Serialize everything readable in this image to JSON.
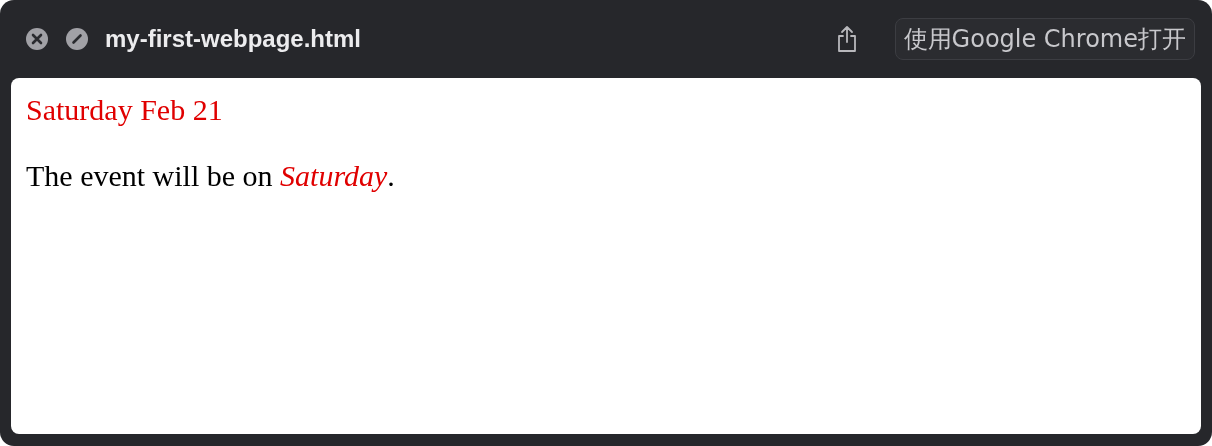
{
  "window": {
    "title": "my-first-webpage.html",
    "open_button": "使用Google Chrome打开"
  },
  "page": {
    "heading": "Saturday Feb 21",
    "paragraph": "The event will be on *Saturday*."
  }
}
